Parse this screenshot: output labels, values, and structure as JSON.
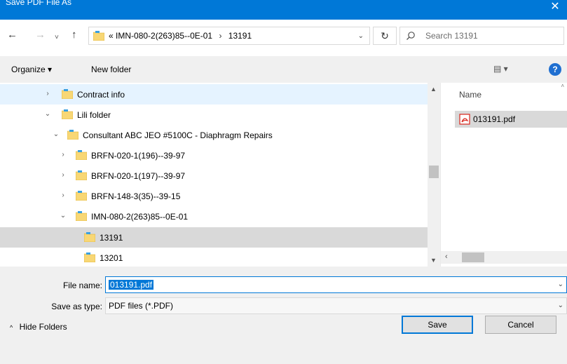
{
  "window": {
    "title": "Save PDF File As",
    "close_glyph": "✕"
  },
  "nav": {
    "back_glyph": "←",
    "forward_glyph": "→",
    "history_glyph": "˅",
    "up_glyph": "↑",
    "address": {
      "overflow_glyph": "«",
      "crumbs": [
        "IMN-080-2(263)85--0E-01",
        "13191"
      ],
      "separator": "›",
      "dropdown_glyph": "⌄"
    },
    "refresh_glyph": "↻",
    "search": {
      "placeholder": "Search 13191"
    }
  },
  "toolbar": {
    "organize_label": "Organize ▾",
    "new_folder_label": "New folder",
    "view_glyph": "▤ ▾",
    "help_glyph": "?"
  },
  "tree": {
    "items": [
      {
        "label": "Contract info",
        "chevron": "›",
        "state": "hover"
      },
      {
        "label": "Lili folder",
        "chevron": "⌄",
        "state": ""
      },
      {
        "label": "Consultant ABC JEO #5100C - Diaphragm Repairs",
        "chevron": "⌄",
        "state": ""
      },
      {
        "label": "BRFN-020-1(196)--39-97",
        "chevron": "›",
        "state": ""
      },
      {
        "label": "BRFN-020-1(197)--39-97",
        "chevron": "›",
        "state": ""
      },
      {
        "label": "BRFN-148-3(35)--39-15",
        "chevron": "›",
        "state": ""
      },
      {
        "label": "IMN-080-2(263)85--0E-01",
        "chevron": "⌄",
        "state": ""
      },
      {
        "label": "13191",
        "chevron": "",
        "state": "selected"
      },
      {
        "label": "13201",
        "chevron": "",
        "state": ""
      }
    ],
    "scroll_up_glyph": "▲",
    "scroll_down_glyph": "▼"
  },
  "files": {
    "column_name": "Name",
    "items": [
      {
        "name": "013191.pdf",
        "icon": "pdf-icon"
      }
    ],
    "scroll_left_glyph": "‹",
    "top_caret_glyph": "˄"
  },
  "form": {
    "file_name_label": "File name:",
    "file_name_value": "013191.pdf",
    "save_type_label": "Save as type:",
    "save_type_value": "PDF files (*.PDF)",
    "dropdown_glyph": "⌄"
  },
  "footer": {
    "hide_folders_label": "Hide Folders",
    "hide_folders_caret": "^",
    "save_label": "Save",
    "cancel_label": "Cancel"
  },
  "colors": {
    "accent": "#0078d7",
    "folder": "#f8d775",
    "pdf_red": "#d9261c",
    "selection": "#d9d9d9",
    "hover": "#e5f3ff"
  }
}
